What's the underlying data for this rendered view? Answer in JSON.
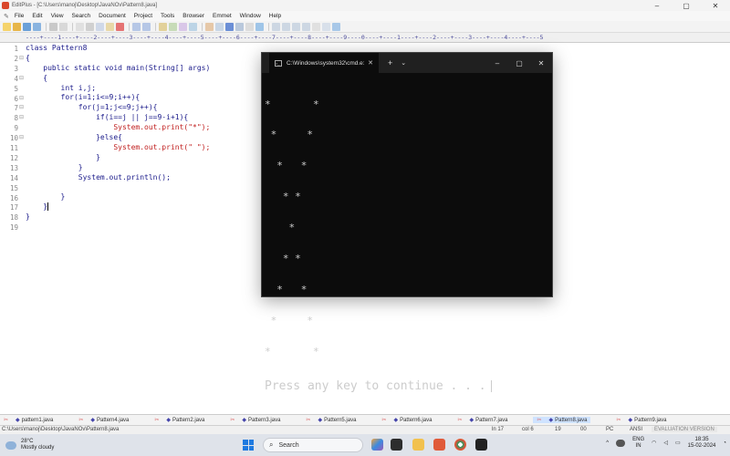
{
  "window": {
    "title": "EditPlus - [C:\\Users\\manoj\\Desktop\\JavaNOv\\Pattern8.java]",
    "controls": [
      "–",
      "▢",
      "✕"
    ]
  },
  "menu": [
    "File",
    "Edit",
    "View",
    "Search",
    "Document",
    "Project",
    "Tools",
    "Browser",
    "Emmet",
    "Window",
    "Help"
  ],
  "ruler": "----+----1----+----2----+----3----+----4----+----5----+----6----+----7----+----8----+----9----0----+----1----+----2----+----3----+----4----+----5",
  "editor": {
    "line_numbers": [
      "1",
      "2",
      "3",
      "4",
      "5",
      "6",
      "7",
      "8",
      "9",
      "10",
      "11",
      "12",
      "13",
      "14",
      "15",
      "16",
      "17",
      "18",
      "19"
    ],
    "fold_markers": {
      "2": "⊟",
      "4": "⊟",
      "6": "⊟",
      "7": "⊟",
      "8": "⊟",
      "10": "⊟"
    },
    "lines": [
      "class Pattern8",
      "{",
      "    public static void main(String[] args)",
      "    {",
      "        int i,j;",
      "        for(i=1;i<=9;i++){",
      "            for(j=1;j<=9;j++){",
      "                if(i==j || j==9-i+1){",
      "                    System.out.print(\"*\");",
      "                }else{",
      "                    System.out.print(\" \");",
      "                }",
      "            }",
      "            System.out.println();",
      "",
      "        }",
      "    }",
      "}",
      ""
    ]
  },
  "cmd": {
    "tab_title": "C:\\Windows\\system32\\cmd.e:",
    "tab_close": "✕",
    "new_tab": "+",
    "dropdown": "⌄",
    "controls": [
      "–",
      "▢",
      "✕"
    ],
    "output": [
      "*       *",
      " *     *",
      "  *   *",
      "   * *",
      "    *",
      "   * *",
      "  *   *",
      " *     *",
      "*       *"
    ],
    "prompt": "Press any key to continue . . ."
  },
  "file_tabs": [
    {
      "name": "pattern1.java",
      "active": false
    },
    {
      "name": "Pattern4.java",
      "active": false
    },
    {
      "name": "Pattern2.java",
      "active": false
    },
    {
      "name": "Pattern3.java",
      "active": false
    },
    {
      "name": "Pattern5.java",
      "active": false
    },
    {
      "name": "Pattern6.java",
      "active": false
    },
    {
      "name": "Pattern7.java",
      "active": false
    },
    {
      "name": "Pattern8.java",
      "active": true
    },
    {
      "name": "Pattern9.java",
      "active": false
    }
  ],
  "status": {
    "path": "C:\\Users\\manoj\\Desktop\\JavaNOv\\Pattern8.java",
    "line": "ln 17",
    "col": "col 6",
    "num1": "19",
    "num2": "00",
    "mode": "PC",
    "encoding": "ANSI",
    "watermark": "EVALUATION VERSION"
  },
  "taskbar": {
    "temperature": "28°C",
    "weather": "Mostly cloudy",
    "search_placeholder": "Search",
    "language_top": "ENG",
    "language_bottom": "IN",
    "time": "18:35",
    "date": "15-02-2024",
    "tray_arrow": "^"
  },
  "colors": {
    "cmd_bg": "#0c0c0c",
    "editor_text": "#1a1a8a",
    "string_text": "#c02020",
    "active_tab": "#cfe3ff"
  }
}
